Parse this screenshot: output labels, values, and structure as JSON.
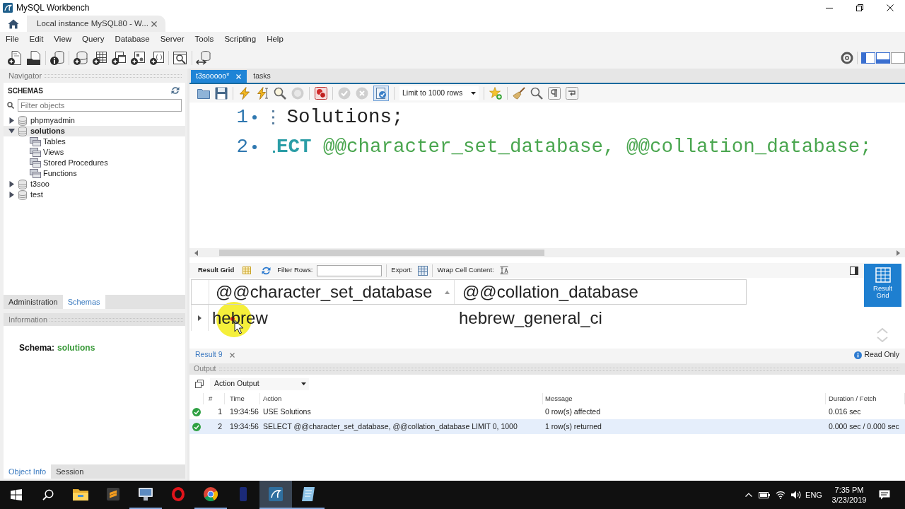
{
  "window": {
    "title": "MySQL Workbench"
  },
  "connection_tabs": [
    {
      "label": "Local instance MySQL80 - W...",
      "selected": true
    }
  ],
  "menu": [
    "File",
    "Edit",
    "View",
    "Query",
    "Database",
    "Server",
    "Tools",
    "Scripting",
    "Help"
  ],
  "layout_toggles": [
    {
      "kind": "sidebar",
      "on": true
    },
    {
      "kind": "output",
      "on": true
    },
    {
      "kind": "secondary",
      "on": false
    }
  ],
  "navigator": {
    "title": "Navigator",
    "section": "SCHEMAS",
    "filter": {
      "placeholder": "Filter objects"
    },
    "schemas": [
      {
        "name": "phpmyadmin",
        "expanded": false,
        "selected": false
      },
      {
        "name": "solutions",
        "expanded": true,
        "selected": true,
        "children": [
          {
            "name": "Tables"
          },
          {
            "name": "Views"
          },
          {
            "name": "Stored Procedures"
          },
          {
            "name": "Functions"
          }
        ]
      },
      {
        "name": "t3soo",
        "expanded": false,
        "selected": false
      },
      {
        "name": "test",
        "expanded": false,
        "selected": false
      }
    ],
    "tabs": [
      {
        "label": "Administration",
        "selected": false
      },
      {
        "label": "Schemas",
        "selected": true
      }
    ]
  },
  "information": {
    "title": "Information",
    "label": "Schema:",
    "value": "solutions",
    "tabs": [
      {
        "label": "Object Info",
        "selected": true
      },
      {
        "label": "Session",
        "selected": false
      }
    ]
  },
  "editor_tabs": [
    {
      "label": "t3sooooo*",
      "selected": true
    },
    {
      "label": "tasks",
      "selected": false
    }
  ],
  "editor_toolbar": {
    "limit": "Limit to 1000 rows",
    "autocommit_on": true
  },
  "editor": {
    "lines": [
      {
        "number": "1",
        "tokens": [
          {
            "kind": "clipped_arms"
          },
          {
            "kind": "space"
          },
          {
            "kind": "plain",
            "text": "Solutions;"
          }
        ]
      },
      {
        "number": "2",
        "tokens": [
          {
            "kind": "clipped_foot"
          },
          {
            "kind": "keyword",
            "text": "ECT"
          },
          {
            "kind": "variable",
            "text": "@@character_set_database, @@collation_database;"
          }
        ]
      }
    ]
  },
  "result": {
    "toolbar": {
      "title": "Result Grid",
      "filter_label": "Filter Rows:",
      "export_label": "Export:",
      "wrap_label": "Wrap Cell Content:"
    },
    "columns": [
      {
        "label": "@@character_set_database",
        "sorted": true
      },
      {
        "label": "@@collation_database",
        "sorted": false
      }
    ],
    "rows": [
      {
        "cells": [
          "hebrew",
          "hebrew_general_ci"
        ],
        "current": true
      }
    ],
    "side_buttons": [
      {
        "label": "Result Grid",
        "selected": true
      }
    ],
    "tabs": [
      {
        "label": "Result 9",
        "selected": true
      }
    ],
    "read_only": "Read Only"
  },
  "output": {
    "title": "Output",
    "selector": "Action Output",
    "columns": [
      "#",
      "Time",
      "Action",
      "Message",
      "Duration / Fetch"
    ],
    "rows": [
      {
        "kind": "success",
        "number": "1",
        "time": "19:34:56",
        "action": "USE Solutions",
        "message": "0 row(s) affected",
        "duration": "0.016 sec",
        "selected": false
      },
      {
        "kind": "success",
        "number": "2",
        "time": "19:34:56",
        "action": "SELECT @@character_set_database, @@collation_database LIMIT 0, 1000",
        "message": "1 row(s) returned",
        "duration": "0.000 sec / 0.000 sec",
        "selected": true
      }
    ]
  },
  "taskbar": {
    "apps": [
      {
        "kind": "file-explorer",
        "running": false,
        "active": false
      },
      {
        "kind": "code-editor",
        "running": false,
        "active": false
      },
      {
        "kind": "remote-desktop",
        "running": true,
        "active": false
      },
      {
        "kind": "opera",
        "running": false,
        "active": false
      },
      {
        "kind": "chrome",
        "running": true,
        "active": false
      },
      {
        "kind": "dark-app",
        "running": false,
        "active": false
      },
      {
        "kind": "workbench",
        "running": true,
        "active": true
      },
      {
        "kind": "notes",
        "running": true,
        "active": false
      }
    ],
    "language": "ENG",
    "time": "7:35 PM",
    "date": "3/23/2019"
  }
}
